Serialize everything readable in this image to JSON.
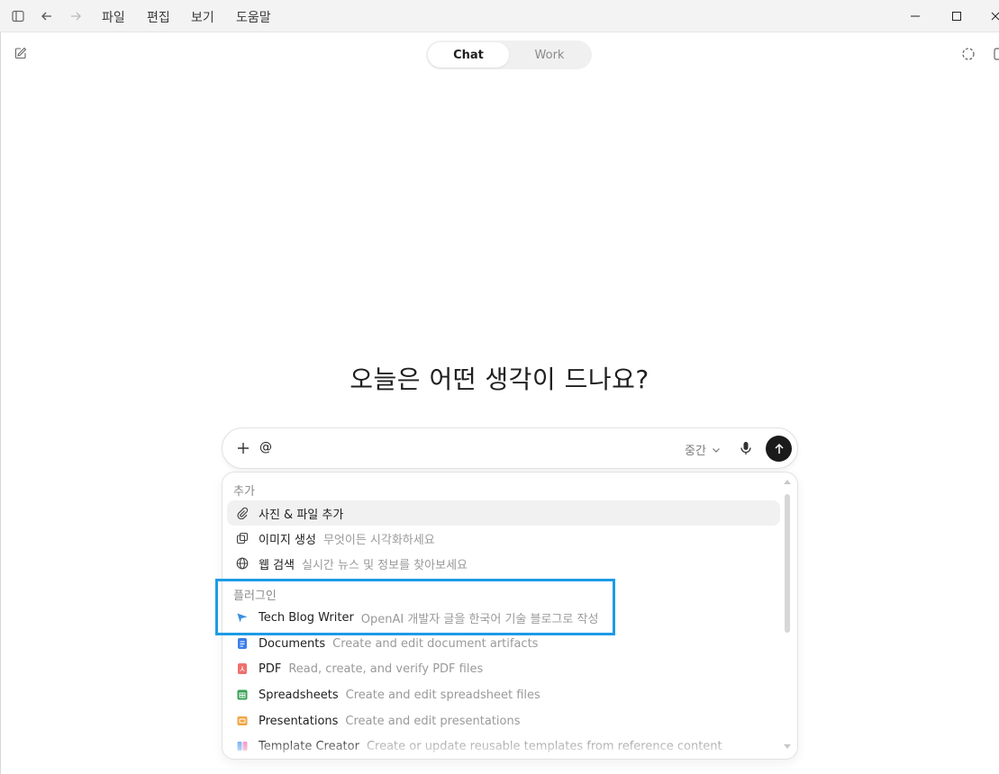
{
  "menu": {
    "items": [
      "파일",
      "편집",
      "보기",
      "도움말"
    ]
  },
  "toolbar": {
    "sidebar_icon": "sidebar-toggle-icon",
    "back_icon": "arrow-left-icon",
    "forward_icon": "arrow-right-icon"
  },
  "window_controls": [
    "minimize",
    "maximize",
    "close"
  ],
  "mode_switch": {
    "chat_label": "Chat",
    "work_label": "Work",
    "selected": "Chat"
  },
  "headline": "오늘은 어떤 생각이 드나요?",
  "composer": {
    "value": "@",
    "effort_label": "중간"
  },
  "popup": {
    "section_add": "추가",
    "add_items": [
      {
        "label": "사진 & 파일 추가",
        "desc": "",
        "icon": "paperclip-icon"
      },
      {
        "label": "이미지 생성",
        "desc": "무엇이든 시각화하세요",
        "icon": "image-gen-icon"
      },
      {
        "label": "웹 검색",
        "desc": "실시간 뉴스 및 정보를 찾아보세요",
        "icon": "globe-icon"
      }
    ],
    "section_plugins": "플러그인",
    "plugin_items": [
      {
        "label": "Tech Blog Writer",
        "desc": "OpenAI 개발자 글을 한국어 기술 블로그로 작성",
        "icon": "send-plane-icon"
      },
      {
        "label": "Documents",
        "desc": "Create and edit document artifacts",
        "icon": "documents-icon"
      },
      {
        "label": "PDF",
        "desc": "Read, create, and verify PDF files",
        "icon": "pdf-icon"
      },
      {
        "label": "Spreadsheets",
        "desc": "Create and edit spreadsheet files",
        "icon": "spreadsheet-icon"
      },
      {
        "label": "Presentations",
        "desc": "Create and edit presentations",
        "icon": "presentation-icon"
      },
      {
        "label": "Template Creator",
        "desc": "Create or update reusable templates from reference content",
        "icon": "template-icon"
      }
    ]
  },
  "colors": {
    "highlight": "#1e9be6",
    "send_button": "#1b1b1b"
  }
}
